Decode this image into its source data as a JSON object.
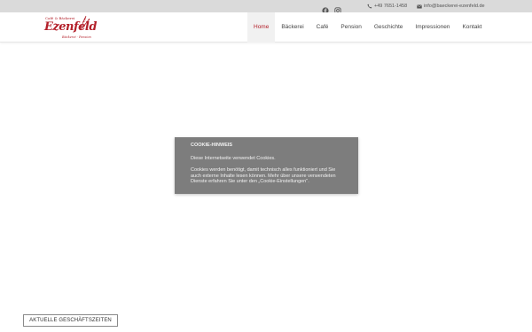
{
  "topbar": {
    "icons": [
      "facebook-icon",
      "instagram-icon",
      "phone-icon",
      "mail-icon"
    ],
    "phone": "+49 7651-1458",
    "email": "info@baeckerei-ezenfeld.de"
  },
  "logo": {
    "small_text": "Café & Bäckerei",
    "name": "Ezenfeld",
    "tagline": "Bäckerei · Pension"
  },
  "nav": {
    "items": [
      "Home",
      "Bäckerei",
      "Café",
      "Pension",
      "Geschichte",
      "Impressionen",
      "Kontakt"
    ],
    "active": "Home"
  },
  "cookie": {
    "title": "COOKIE-HINWEIS",
    "line1": "Diese Internetseite verwendet Cookies.",
    "line2": "Cookies werden benötigt, damit technisch alles funktioniert und Sie auch externe Inhalte lesen können. Mehr über unsere verwendeten Dienste erfahren Sie unter den „Cookie-Einstellungen\"."
  },
  "hours_button": "AKTUELLE GESCHÄFTSZEITEN",
  "colors": {
    "accent": "#b3202a",
    "topbar_bg": "#dadada",
    "modal_bg": "#7d7d7d"
  }
}
